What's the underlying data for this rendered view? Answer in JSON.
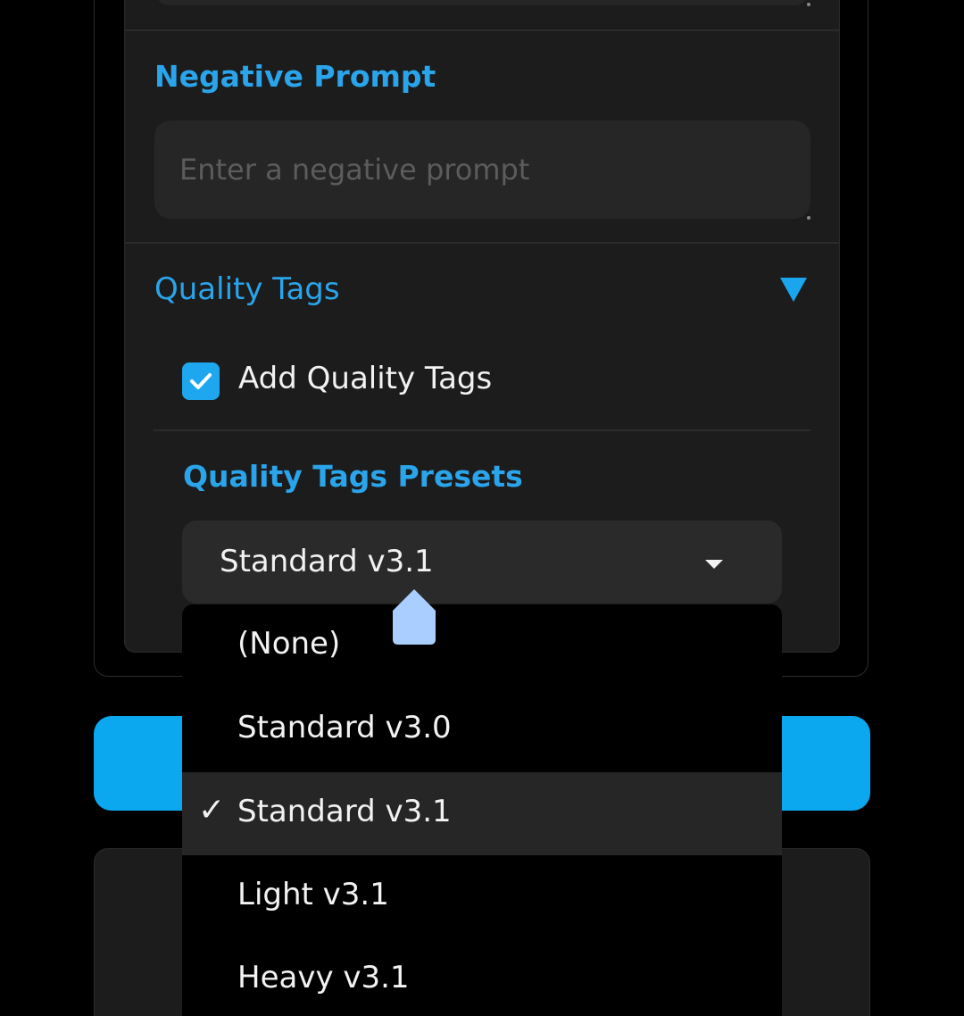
{
  "negative_prompt": {
    "label": "Negative Prompt",
    "placeholder": "Enter a negative prompt",
    "value": ""
  },
  "quality_tags": {
    "title": "Quality Tags",
    "expanded_icon": "triangle-down-icon",
    "add_quality_tags": {
      "label": "Add Quality Tags",
      "checked": true
    },
    "presets": {
      "label": "Quality Tags Presets",
      "selected": "Standard v3.1",
      "options": [
        {
          "label": "(None)",
          "selected": false
        },
        {
          "label": "Standard v3.0",
          "selected": false
        },
        {
          "label": "Standard v3.1",
          "selected": true
        },
        {
          "label": "Light v3.1",
          "selected": false
        },
        {
          "label": "Heavy v3.1",
          "selected": false
        }
      ],
      "check_mark": "✓"
    }
  },
  "colors": {
    "accent": "#2aa4ea",
    "button": "#0ba8f0",
    "panel": "#1c1c1c",
    "input": "#262626",
    "drag_handle": "#a9ceff"
  }
}
